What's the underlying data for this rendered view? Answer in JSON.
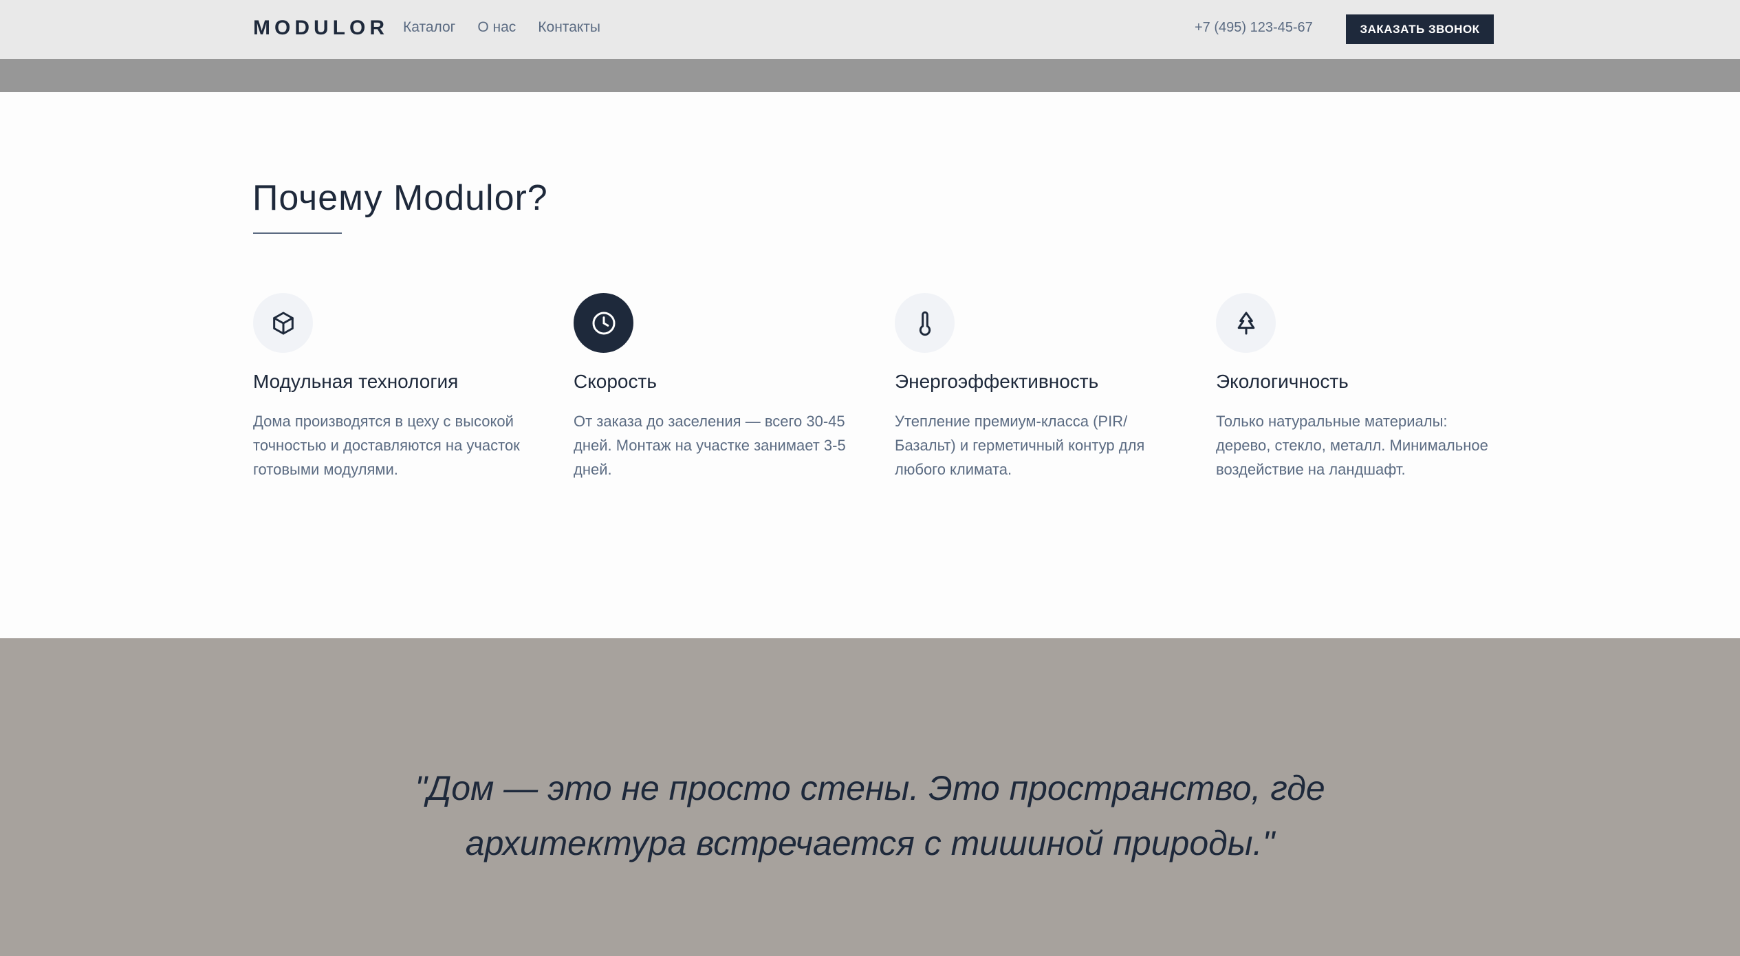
{
  "header": {
    "logo": "MODULOR",
    "nav": [
      "Каталог",
      "О нас",
      "Контакты"
    ],
    "phone": "+7 (495) 123-45-67",
    "cta_label": "ЗАКАЗАТЬ ЗВОНОК"
  },
  "features": {
    "title": "Почему Modulor?",
    "items": [
      {
        "icon": "cube-icon",
        "title": "Модульная технология",
        "text": "Дома производятся в цеху с высокой точностью и доставляются на участок готовыми модулями."
      },
      {
        "icon": "clock-icon",
        "title": "Скорость",
        "text": "От заказа до заселения — всего 30-45 дней. Монтаж на участке занимает 3-5 дней."
      },
      {
        "icon": "thermometer-icon",
        "title": "Энергоэффективность",
        "text": "Утепление премиум-класса (PIR/Базальт) и герметичный контур для любого климата."
      },
      {
        "icon": "tree-icon",
        "title": "Экологичность",
        "text": "Только натуральные материалы: дерево, стекло, металл. Минимальное воздействие на ландшафт."
      }
    ]
  },
  "quote": {
    "text": "\"Дом — это не просто стены. Это пространство, где архитектура встречается с тишиной природы.\""
  },
  "colors": {
    "primary": "#1e293b",
    "muted": "#5b6b82",
    "header_bg": "#e9e9e9",
    "quote_bg": "#a7a29d"
  }
}
